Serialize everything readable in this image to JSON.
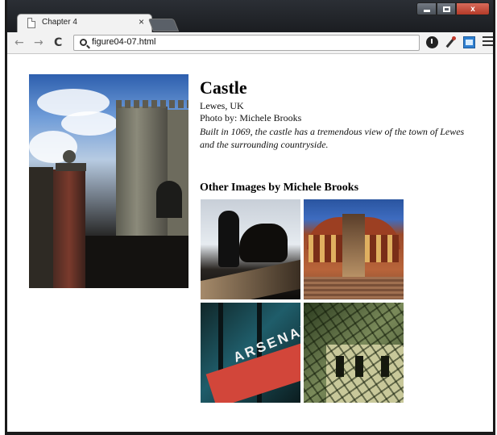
{
  "browser": {
    "tab_title": "Chapter 4",
    "tab_close": "×",
    "url": "figure04-07.html",
    "nav_back": "←",
    "nav_forward": "→",
    "nav_reload": "C",
    "window_close": "x"
  },
  "page": {
    "title": "Castle",
    "location": "Lewes, UK",
    "credit": "Photo by: Michele Brooks",
    "description": "Built in 1069, the castle has a tremendous view of the town of Lewes and the surrounding countryside.",
    "other_images_heading": "Other Images by Michele Brooks",
    "thumbnail_letters": "ARSENAL"
  },
  "colors": {
    "titlebar": "#1b1d21",
    "toolbar": "#f2f2f2",
    "page_background": "#ffffff",
    "text": "#000000"
  }
}
